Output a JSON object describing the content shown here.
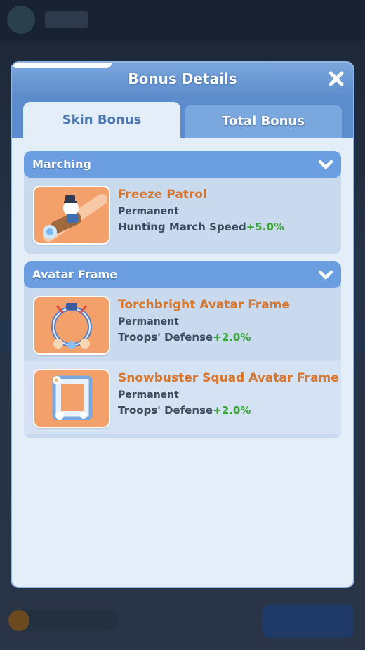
{
  "dialog": {
    "title": "Bonus Details",
    "close_icon": "close-icon"
  },
  "tabs": [
    {
      "label": "Skin Bonus",
      "active": true
    },
    {
      "label": "Total Bonus",
      "active": false
    }
  ],
  "sections": [
    {
      "label": "Marching",
      "icon": "chevron-down-icon",
      "items": [
        {
          "name": "Freeze Patrol",
          "duration": "Permanent",
          "stat": "Hunting March Speed",
          "value": "+5.0%",
          "image": "snowman-rider-icon"
        }
      ]
    },
    {
      "label": "Avatar Frame",
      "icon": "chevron-down-icon",
      "items": [
        {
          "name": "Torchbright Avatar Frame",
          "duration": "Permanent",
          "stat": "Troops' Defense",
          "value": "+2.0%",
          "image": "torchbright-frame-icon"
        },
        {
          "name": "Snowbuster Squad Avatar Frame",
          "duration": "Permanent",
          "stat": "Troops' Defense",
          "value": "+2.0%",
          "image": "snowbuster-frame-icon"
        }
      ]
    }
  ],
  "colors": {
    "item_name": "#d7772f",
    "bonus_value": "#39a534",
    "header_blue": "#6a9ee0",
    "thumb_bg": "#f0a56e"
  }
}
